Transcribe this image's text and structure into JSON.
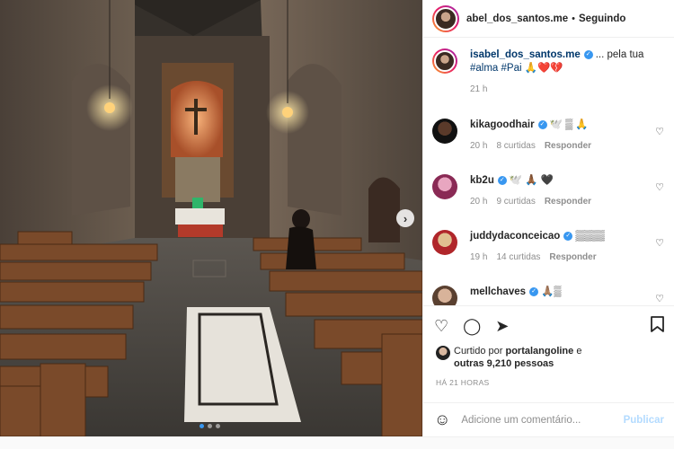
{
  "header": {
    "username": "abel_dos_santos.me",
    "separator": "•",
    "follow_status": "Seguindo",
    "more": "···"
  },
  "caption": {
    "username": "isabel_dos_santos.me",
    "text_prefix": "... pela tua",
    "hashtags": "#alma #Pai",
    "emojis": "🙏❤️💔",
    "time": "21 h"
  },
  "comments": [
    {
      "username": "kikagoodhair",
      "verified": true,
      "text": "🕊️ ▒ 🙏",
      "time": "20 h",
      "likes": "8 curtidas",
      "reply": "Responder"
    },
    {
      "username": "kb2u",
      "verified": true,
      "text": "🕊️ 🙏🏾 🖤",
      "time": "20 h",
      "likes": "9 curtidas",
      "reply": "Responder"
    },
    {
      "username": "juddydaconceicao",
      "verified": true,
      "text": "▒▒▒▒",
      "time": "19 h",
      "likes": "14 curtidas",
      "reply": "Responder"
    },
    {
      "username": "mellchaves",
      "verified": true,
      "text": "🙏🏽▒",
      "time": "",
      "likes": "",
      "reply": ""
    }
  ],
  "likes": {
    "prefix": "Curtido por",
    "user": "portalangoline",
    "middle": "e",
    "others": "outras 9,210 pessoas"
  },
  "post_age": "HÁ 21 HORAS",
  "comment_box": {
    "placeholder": "Adicione um comentário...",
    "publish_label": "Publicar"
  },
  "carousel": {
    "next": "›",
    "count": 3,
    "active": 0
  },
  "icons": {
    "heart": "heart-icon",
    "comment": "comment-icon",
    "share": "share-icon",
    "save": "bookmark-icon",
    "emoji": "emoji-icon"
  },
  "colors": {
    "accent": "#3897f0",
    "text": "#262626",
    "muted": "#8e8e8e",
    "publish_disabled": "#b3dbff"
  }
}
